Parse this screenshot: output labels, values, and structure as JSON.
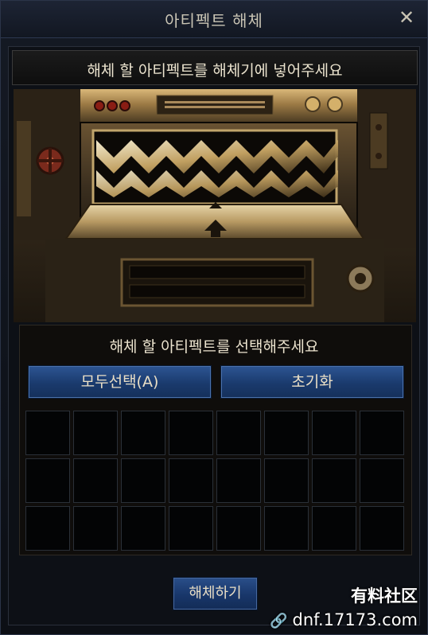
{
  "window": {
    "title": "아티펙트 해체",
    "close_glyph": "✕"
  },
  "machine": {
    "instruction": "해체 할 아티펙트를 해체기에 넣어주세요"
  },
  "selection": {
    "instruction": "해체 할 아티펙트를 선택해주세요",
    "select_all_label": "모두선택(A)",
    "reset_label": "초기화",
    "slot_rows": 3,
    "slot_cols": 8
  },
  "footer": {
    "disassemble_label": "해체하기"
  },
  "watermark": {
    "site_name": "有料社区",
    "url": "dnf.17173.com",
    "link_glyph": "🔗"
  },
  "colors": {
    "button_blue": "#1f4278",
    "brass": "#b08a4e",
    "panel_dark": "#0d1016"
  }
}
